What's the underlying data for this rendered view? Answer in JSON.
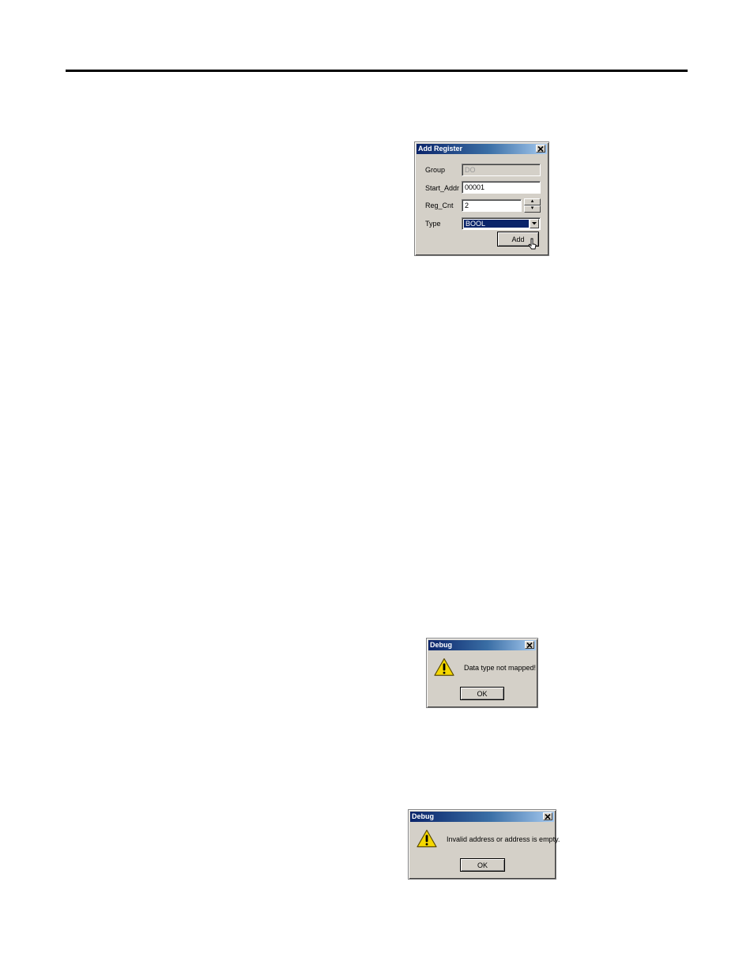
{
  "add_register_dialog": {
    "title": "Add Register",
    "close_glyph": "✕",
    "group_label": "Group",
    "group_value": "DO",
    "start_addr_label": "Start_Addr",
    "start_addr_value": "00001",
    "reg_cnt_label": "Reg_Cnt",
    "reg_cnt_value": "2",
    "spin_up_glyph": "▴",
    "spin_down_glyph": "▾",
    "type_label": "Type",
    "type_value": "BOOL",
    "add_button_label": "Add"
  },
  "debug_dialog_1": {
    "title": "Debug",
    "message": "Data type not mapped!",
    "ok_label": "OK",
    "icon": "warning-icon"
  },
  "debug_dialog_2": {
    "title": "Debug",
    "message": "Invalid address or address is empty.",
    "ok_label": "OK",
    "icon": "warning-icon"
  },
  "colors": {
    "titlebar_start": "#0a246a",
    "titlebar_end": "#a6caf0",
    "dialog_face": "#d4d0c8",
    "selection": "#0a246a",
    "warning_yellow": "#f5d800"
  }
}
